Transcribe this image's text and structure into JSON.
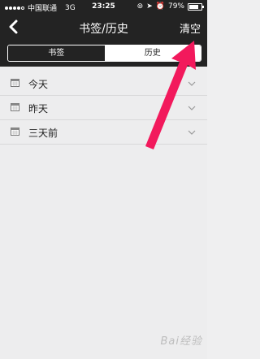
{
  "status_bar": {
    "carrier": "中国联通",
    "network": "3G",
    "time": "23:25",
    "battery": "79%",
    "battery_level": 0.79
  },
  "nav": {
    "title": "书签/历史",
    "clear_label": "清空"
  },
  "segments": {
    "bookmarks": "书签",
    "history": "历史",
    "selected": "历史"
  },
  "history": {
    "groups": [
      {
        "label": "今天"
      },
      {
        "label": "昨天"
      },
      {
        "label": "三天前"
      }
    ]
  },
  "annotation": {
    "arrow_color": "#f2195c"
  },
  "watermark": {
    "text": "Bai经验"
  },
  "colors": {
    "topbar": "#232323",
    "background": "#ededee"
  }
}
